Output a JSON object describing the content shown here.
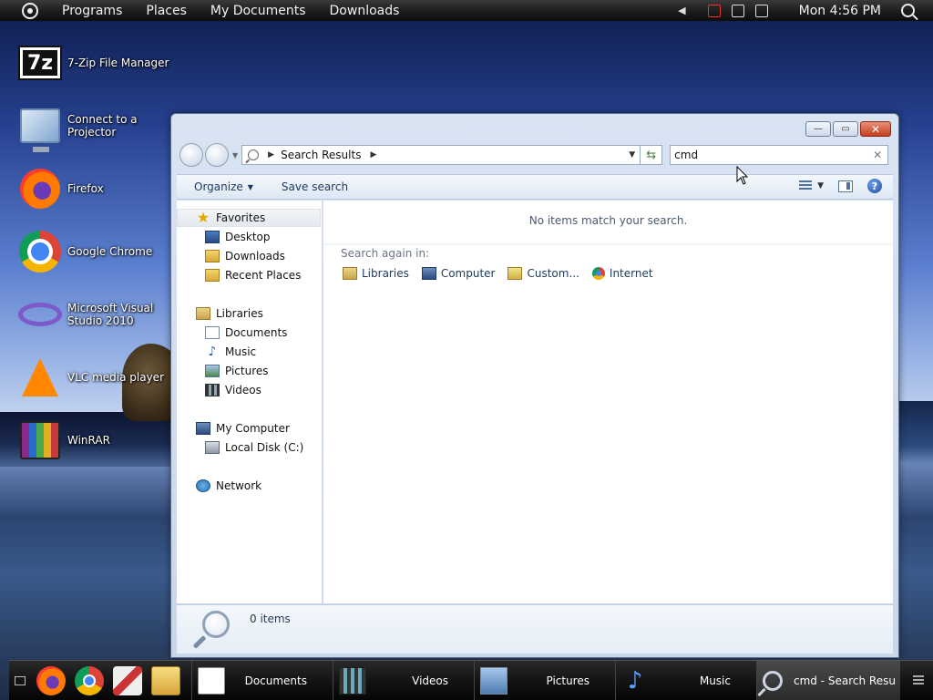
{
  "top_panel": {
    "menu": [
      "Programs",
      "Places",
      "My Documents",
      "Downloads"
    ],
    "clock": "Mon 4:56 PM"
  },
  "desktop_icons": [
    {
      "label": "7-Zip File Manager",
      "icon": "7zip-icon"
    },
    {
      "label": "Connect to a Projector",
      "icon": "projector-icon"
    },
    {
      "label": "Firefox",
      "icon": "firefox-icon"
    },
    {
      "label": "Google Chrome",
      "icon": "chrome-icon"
    },
    {
      "label": "Microsoft Visual Studio 2010",
      "icon": "visual-studio-icon"
    },
    {
      "label": "VLC media player",
      "icon": "vlc-icon"
    },
    {
      "label": "WinRAR",
      "icon": "winrar-icon"
    }
  ],
  "window": {
    "controls": {
      "minimize": "—",
      "maximize": "▭",
      "close": "✕"
    },
    "address": {
      "crumb": "Search Results"
    },
    "search": {
      "value": "cmd"
    },
    "toolbar": {
      "organize": "Organize",
      "save_search": "Save search"
    },
    "nav": {
      "favorites": "Favorites",
      "favorites_items": [
        "Desktop",
        "Downloads",
        "Recent Places"
      ],
      "libraries": "Libraries",
      "libraries_items": [
        "Documents",
        "Music",
        "Pictures",
        "Videos"
      ],
      "computer": "My Computer",
      "computer_items": [
        "Local Disk (C:)"
      ],
      "network": "Network"
    },
    "content": {
      "no_items": "No items match your search.",
      "search_again": "Search again in:",
      "links": [
        "Libraries",
        "Computer",
        "Custom...",
        "Internet"
      ]
    },
    "details": {
      "count": "0 items"
    }
  },
  "taskbar": {
    "tasks": [
      {
        "label": "Documents"
      },
      {
        "label": "Videos"
      },
      {
        "label": "Pictures"
      },
      {
        "label": "Music"
      },
      {
        "label": "cmd - Search Resu..."
      }
    ]
  }
}
